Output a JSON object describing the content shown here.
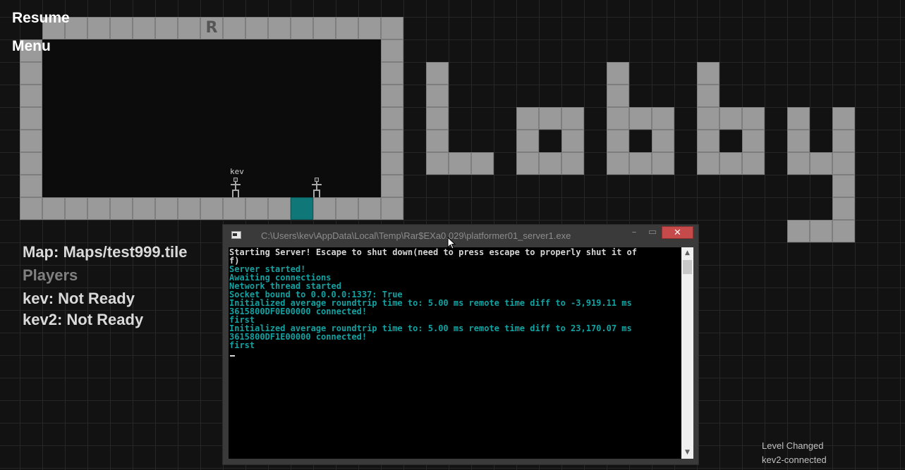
{
  "menu": {
    "resume_label": "Resume",
    "menu_label": "Menu"
  },
  "map": {
    "respawn_tile_letter": "R",
    "tile_color": "#9a9a9a",
    "teal_tile_color": "#0f7777",
    "players_in_room": [
      {
        "name": "kev"
      },
      {
        "name": ""
      }
    ]
  },
  "decor_text": "Lobby",
  "lobby": {
    "map_line": "Map: Maps/test999.tile",
    "players_heading": "Players",
    "players": [
      "kev: Not Ready",
      "kev2: Not Ready"
    ]
  },
  "console": {
    "title": "C:\\Users\\kev\\AppData\\Local\\Temp\\Rar$EXa0.029\\platformer01_server1.exe",
    "minimize_glyph": "–",
    "maximize_glyph": "▭",
    "close_glyph": "✕",
    "scroll_up_glyph": "▲",
    "scroll_down_glyph": "▼",
    "lines": [
      {
        "text": "Starting Server! Escape to shut down(need to press escape to properly shut it of",
        "color": "white"
      },
      {
        "text": "f)",
        "color": "white"
      },
      {
        "text": "Server started!",
        "color": "teal"
      },
      {
        "text": "Awaiting connections",
        "color": "teal"
      },
      {
        "text": "Network thread started",
        "color": "teal"
      },
      {
        "text": "Socket bound to 0.0.0.0:1337: True",
        "color": "teal"
      },
      {
        "text": "Initialized average roundtrip time to: 5.00 ms remote time diff to -3,919.11 ms",
        "color": "teal"
      },
      {
        "text": "3615800DF0E00000 connected!",
        "color": "teal"
      },
      {
        "text": "first",
        "color": "teal"
      },
      {
        "text": "Initialized average roundtrip time to: 5.00 ms remote time diff to 23,170.07 ms",
        "color": "teal"
      },
      {
        "text": "3615800DF1E00000 connected!",
        "color": "teal"
      },
      {
        "text": "first",
        "color": "teal"
      }
    ]
  },
  "status_log": [
    "Level Changed",
    "kev2-connected"
  ]
}
